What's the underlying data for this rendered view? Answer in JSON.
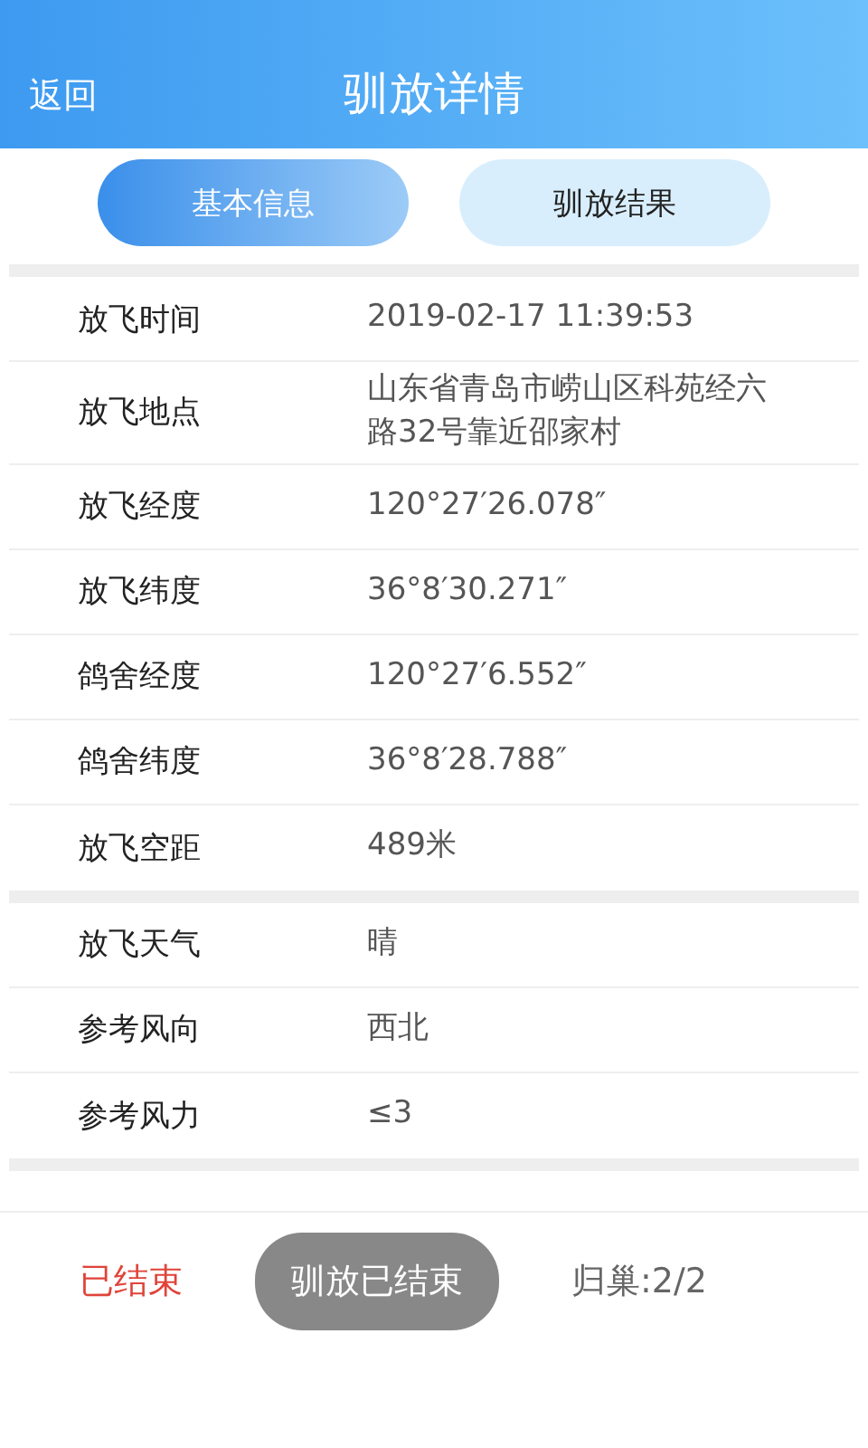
{
  "header": {
    "back": "返回",
    "title": "驯放详情"
  },
  "tabs": [
    {
      "label": "基本信息",
      "selected": true
    },
    {
      "label": "驯放结果",
      "selected": false
    }
  ],
  "groups": [
    {
      "rows": [
        {
          "label": "放飞时间",
          "value": "2019-02-17 11:39:53"
        },
        {
          "label": "放飞地点",
          "value": "山东省青岛市崂山区科苑经六路32号靠近邵家村"
        },
        {
          "label": "放飞经度",
          "value": "120°27′26.078″"
        },
        {
          "label": "放飞纬度",
          "value": "36°8′30.271″"
        },
        {
          "label": "鸽舍经度",
          "value": "120°27′6.552″"
        },
        {
          "label": "鸽舍纬度",
          "value": "36°8′28.788″"
        },
        {
          "label": "放飞空距",
          "value": "489米"
        }
      ]
    },
    {
      "rows": [
        {
          "label": "放飞天气",
          "value": "晴"
        },
        {
          "label": "参考风向",
          "value": "西北"
        },
        {
          "label": "参考风力",
          "value": "≤3"
        }
      ]
    }
  ],
  "footer": {
    "status": "已结束",
    "button": {
      "label": "驯放已结束",
      "disabled": true
    },
    "return_count": "归巢:2/2"
  }
}
